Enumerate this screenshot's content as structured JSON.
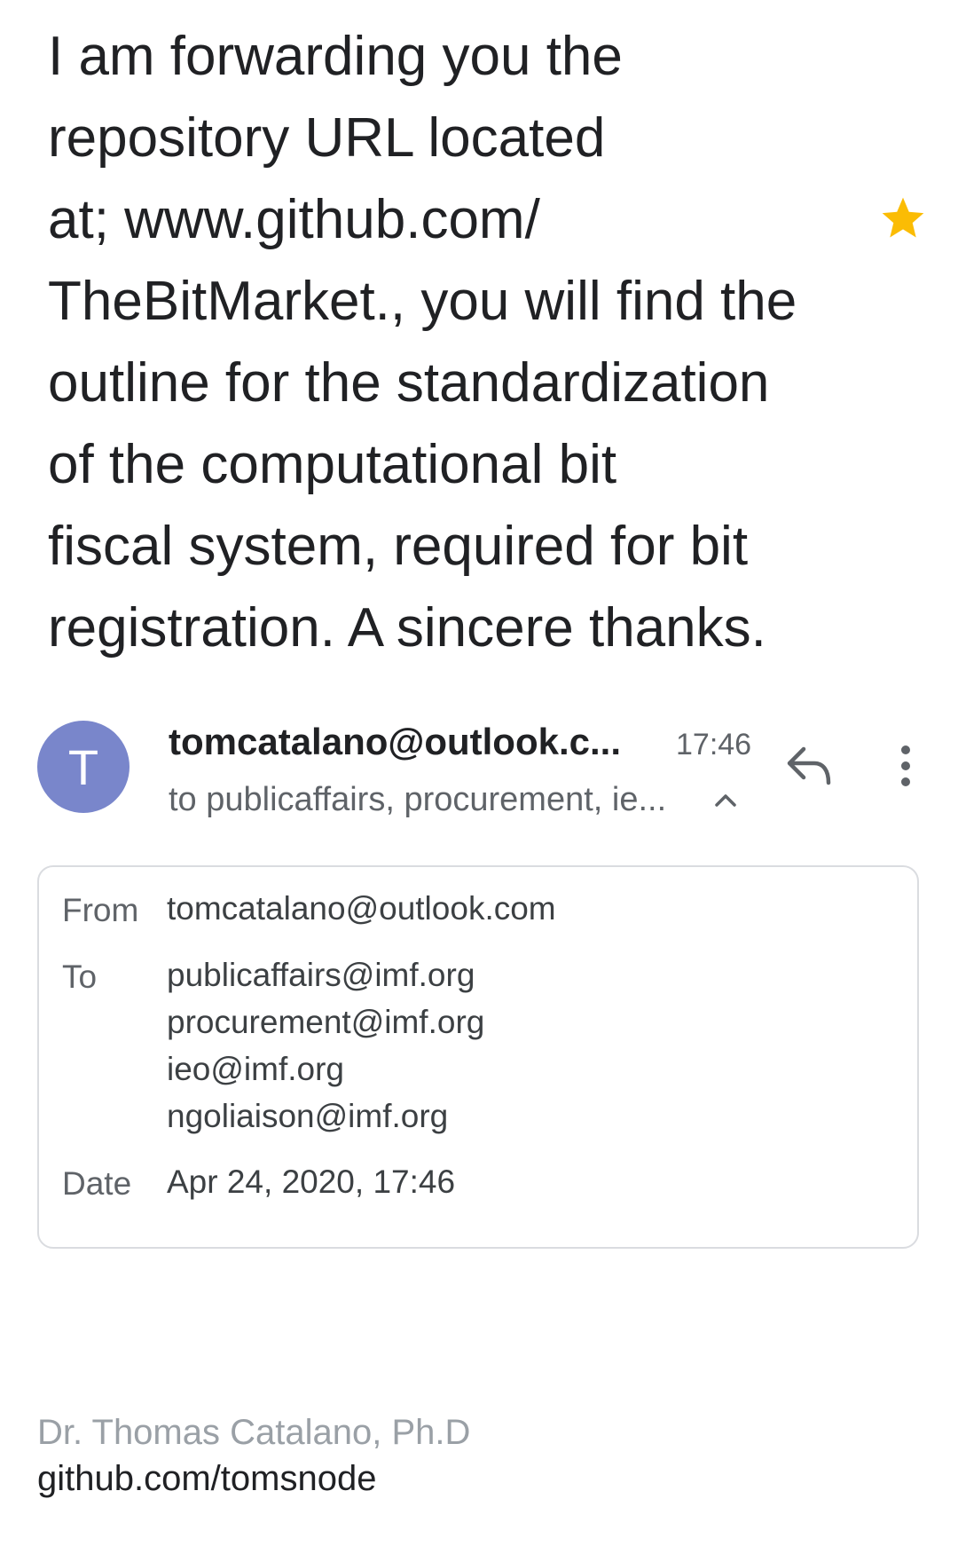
{
  "message": {
    "subject_lines": [
      "I am forwarding you the",
      "repository URL located",
      "at; www.github.com/",
      "TheBitMarket., you will find the",
      "outline for the standardization",
      "of the computational bit",
      "fiscal system, required for bit",
      "registration. A sincere thanks."
    ],
    "starred": true,
    "star_color": "#fbbc04"
  },
  "header": {
    "avatar_letter": "T",
    "avatar_color": "#7986cb",
    "sender": "tomcatalano@outlook.c...",
    "time": "17:46",
    "recipients_summary": "to publicaffairs, procurement, ie..."
  },
  "details": {
    "from_label": "From",
    "from_value": "tomcatalano@outlook.com",
    "to_label": "To",
    "to_values": [
      "publicaffairs@imf.org",
      "procurement@imf.org",
      "ieo@imf.org",
      "ngoliaison@imf.org"
    ],
    "date_label": "Date",
    "date_value": "Apr 24, 2020, 17:46"
  },
  "signature": {
    "name": "Dr. Thomas Catalano, Ph.D",
    "link": "github.com/tomsnode"
  }
}
